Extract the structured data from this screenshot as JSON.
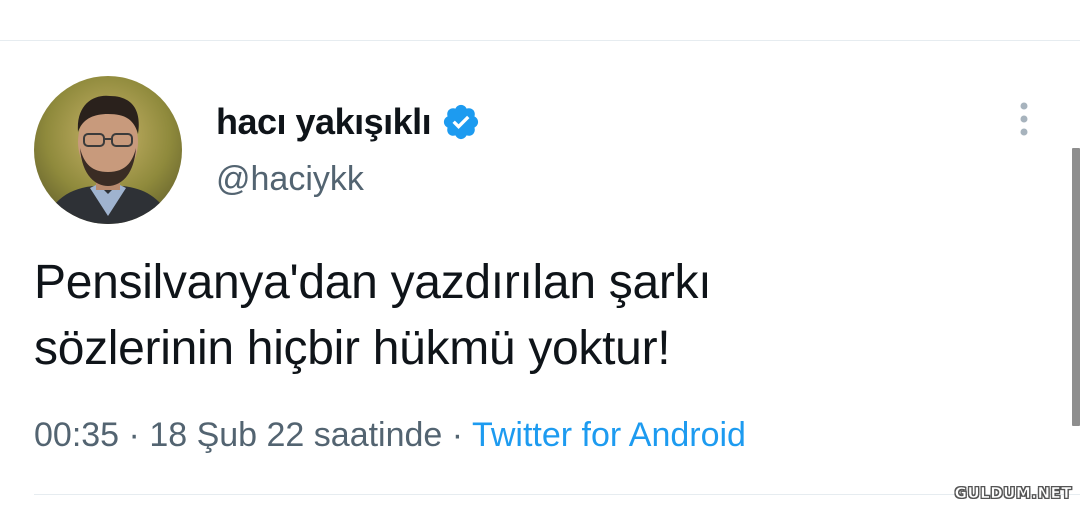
{
  "author": {
    "display_name": "hacı yakışıklı",
    "handle": "@haciykk",
    "verified": true
  },
  "tweet": {
    "text_line1": "Pensilvanya'dan yazdırılan şarkı",
    "text_line2": "sözlerinin hiçbir hükmü yoktur!"
  },
  "meta": {
    "time": "00:35",
    "separator1": " · ",
    "date": "18 Şub 22 saatinde",
    "separator2": " · ",
    "source": "Twitter for Android"
  },
  "watermark": "GULDUM.NET",
  "icons": {
    "verified": "verified-badge-icon",
    "more": "more-options-icon"
  },
  "colors": {
    "accent": "#1d9bf0",
    "text_primary": "#0f1419",
    "text_secondary": "#536471"
  }
}
